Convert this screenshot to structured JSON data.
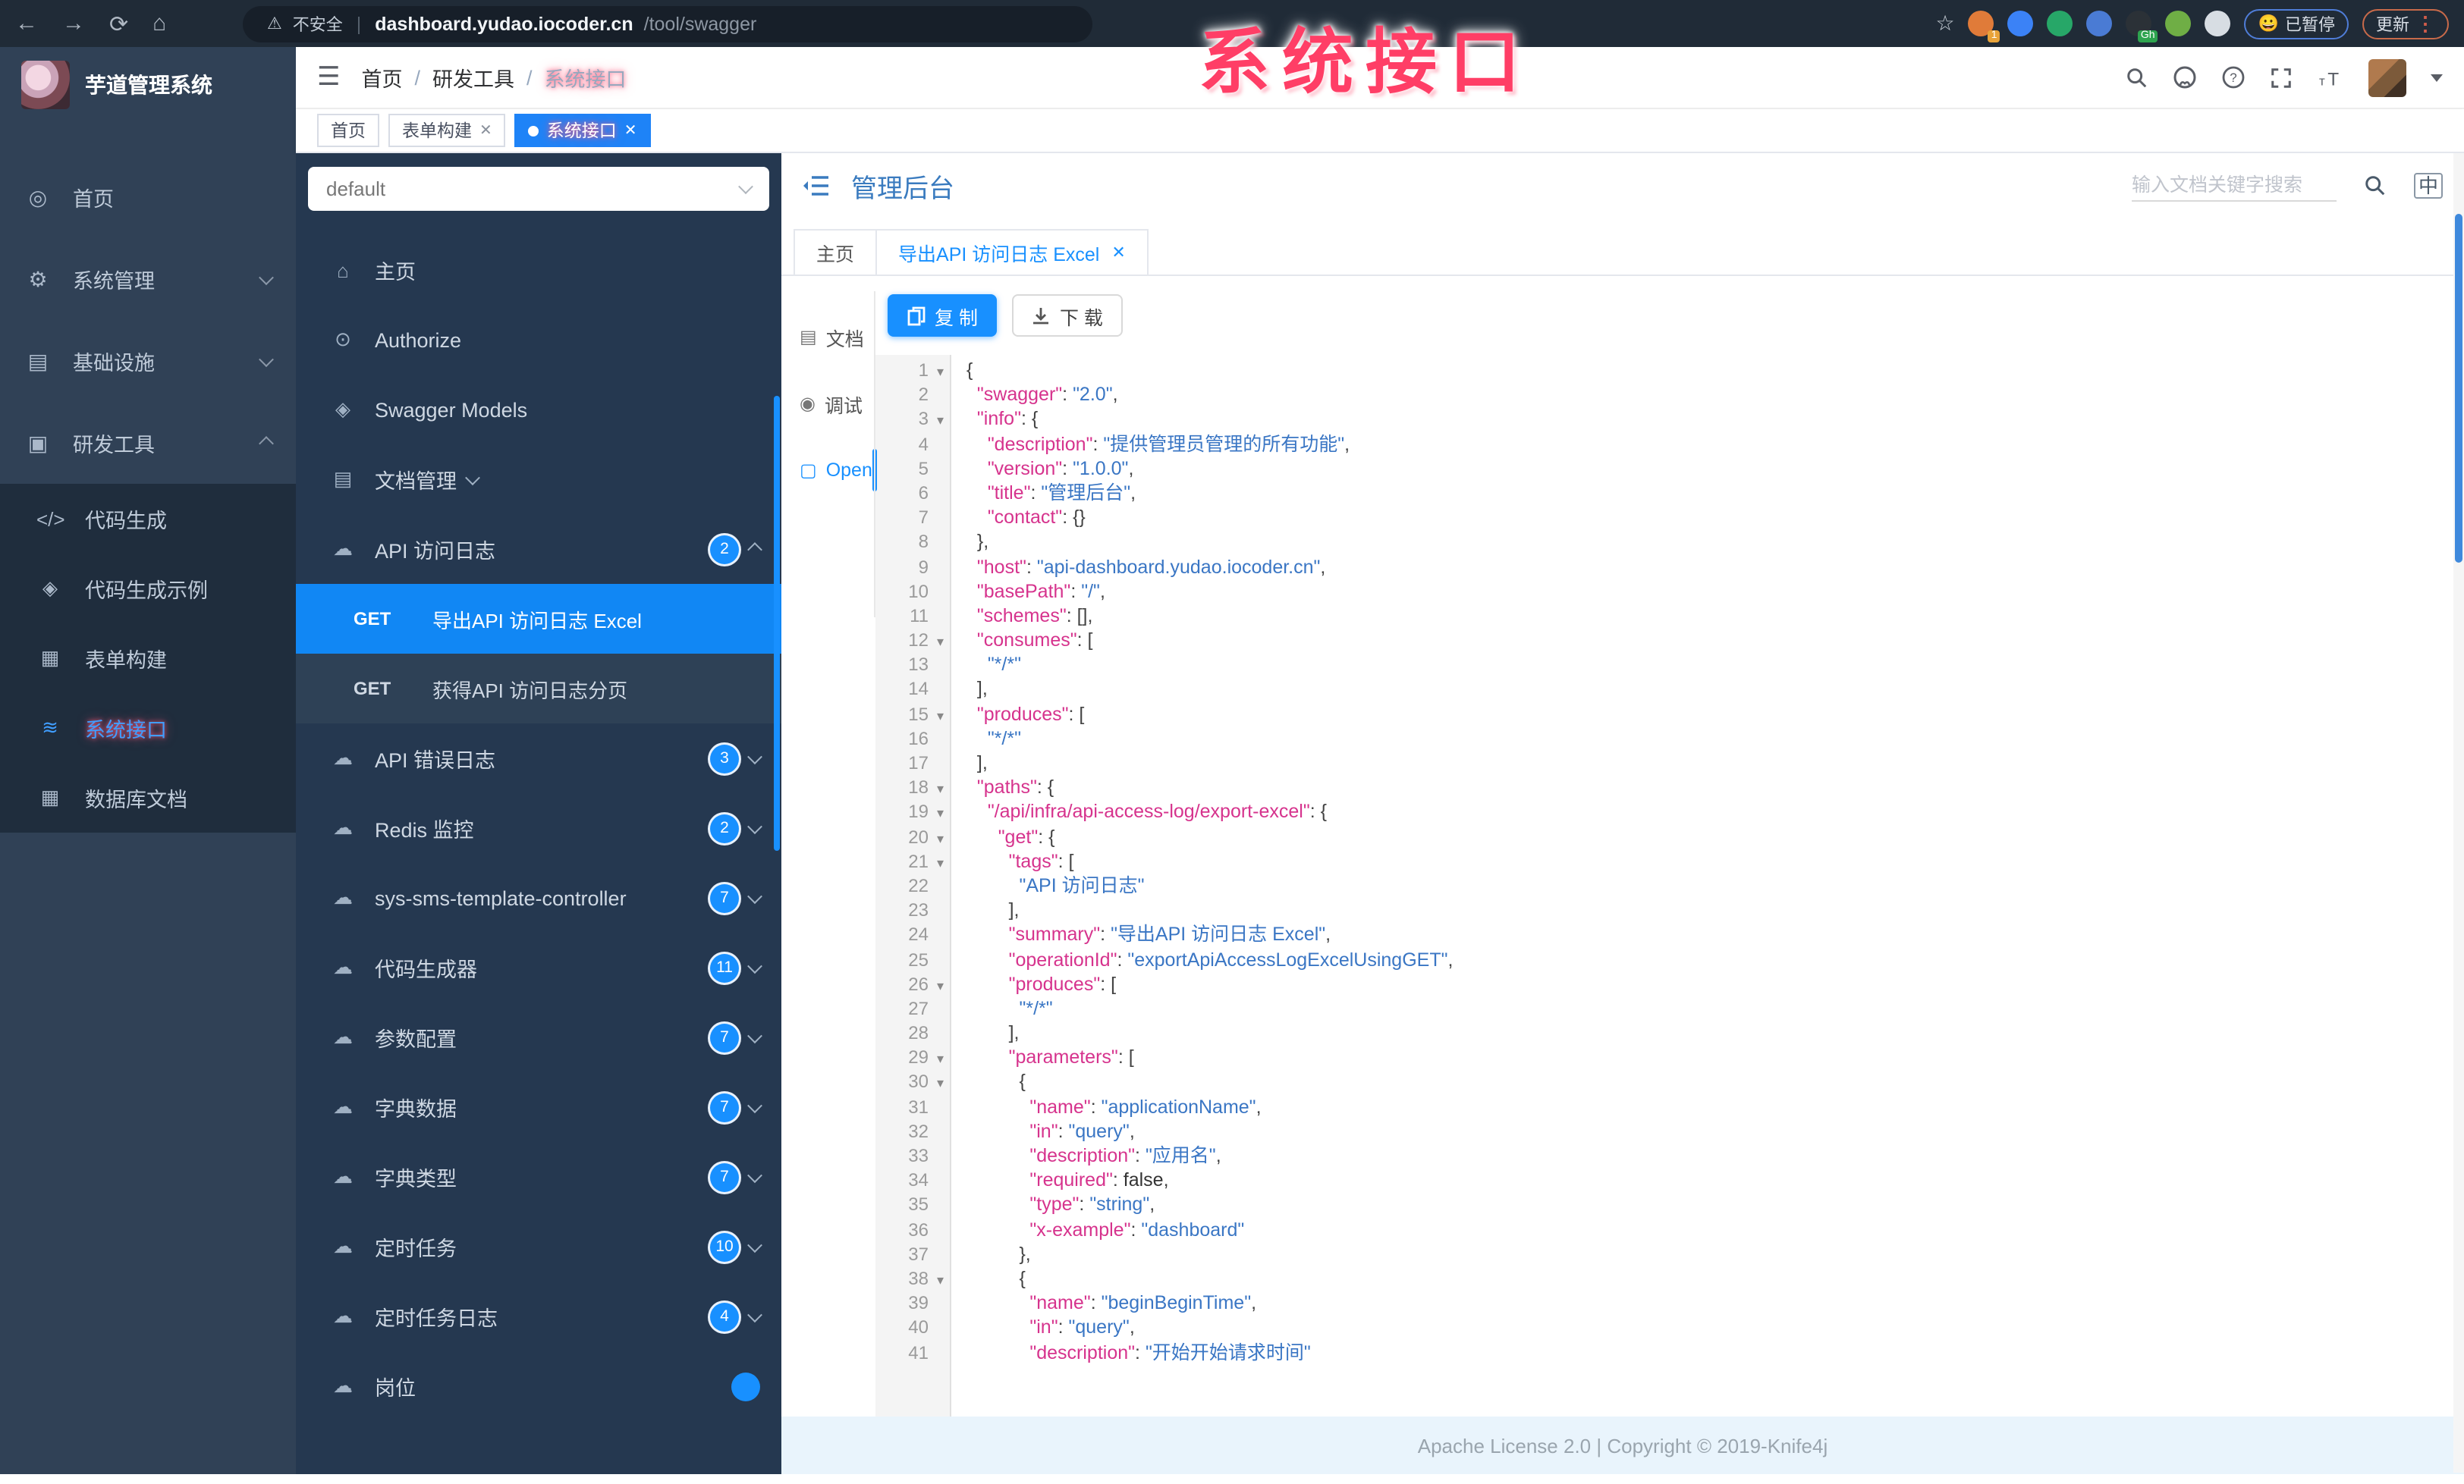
{
  "browser": {
    "back_icon": "←",
    "forward_icon": "→",
    "reload_icon": "⟳",
    "home_icon": "⌂",
    "warning_icon": "⚠",
    "security_label": "不安全",
    "url_host": "dashboard.yudao.iocoder.cn",
    "url_path": "/tool/swagger",
    "bookmark_icon": "☆",
    "extensions": [
      {
        "name": "ext-orange-icon",
        "color": "#e07b39",
        "badge": "1"
      },
      {
        "name": "ext-blue-drop-icon",
        "color": "#3b82f6",
        "badge": ""
      },
      {
        "name": "ext-green-check-icon",
        "color": "#27a768",
        "badge": ""
      },
      {
        "name": "ext-blue-puzzle-icon",
        "color": "#4a7bd4",
        "badge": ""
      },
      {
        "name": "ext-github-icon",
        "color": "#2b3137",
        "badge": "Gh"
      },
      {
        "name": "ext-green-alien-icon",
        "color": "#6fae45",
        "badge": ""
      },
      {
        "name": "ext-white-paw-icon",
        "color": "#d7dde3",
        "badge": ""
      }
    ],
    "paused_pill": "已暂停",
    "paused_emoji": "😀",
    "update_pill": "更新",
    "menu_dots": "⋮"
  },
  "annotation": {
    "text": "系统接口"
  },
  "app_sidebar": {
    "title": "芋道管理系统",
    "items": [
      {
        "label": "首页",
        "icon": "dashboard-icon",
        "glyph": "◎",
        "type": "top"
      },
      {
        "label": "系统管理",
        "icon": "gear-icon",
        "glyph": "⚙",
        "type": "top",
        "chev": "down"
      },
      {
        "label": "基础设施",
        "icon": "infrastructure-icon",
        "glyph": "▤",
        "type": "top",
        "chev": "down"
      },
      {
        "label": "研发工具",
        "icon": "dev-tools-icon",
        "glyph": "▣",
        "type": "top",
        "chev": "up"
      },
      {
        "label": "代码生成",
        "icon": "code-icon",
        "glyph": "</>",
        "type": "sub"
      },
      {
        "label": "代码生成示例",
        "icon": "shield-check-icon",
        "glyph": "◈",
        "type": "sub"
      },
      {
        "label": "表单构建",
        "icon": "form-icon",
        "glyph": "▦",
        "type": "sub"
      },
      {
        "label": "系统接口",
        "icon": "api-icon",
        "glyph": "≋",
        "type": "sub",
        "active": true
      },
      {
        "label": "数据库文档",
        "icon": "database-icon",
        "glyph": "▦",
        "type": "sub"
      }
    ]
  },
  "header": {
    "breadcrumb": [
      "首页",
      "研发工具",
      "系统接口"
    ],
    "separator": "/"
  },
  "tags": [
    {
      "label": "首页",
      "closable": false,
      "active": false
    },
    {
      "label": "表单构建",
      "closable": true,
      "active": false
    },
    {
      "label": "系统接口",
      "closable": true,
      "active": true
    }
  ],
  "swagger_sidebar": {
    "group_selected": "default",
    "items": [
      {
        "label": "主页",
        "icon": "home-icon",
        "glyph": "⌂"
      },
      {
        "label": "Authorize",
        "icon": "authorize-icon",
        "glyph": "⊙"
      },
      {
        "label": "Swagger Models",
        "icon": "models-icon",
        "glyph": "◈"
      },
      {
        "label": "文档管理",
        "icon": "doc-manage-icon",
        "glyph": "▤",
        "chev": "down"
      },
      {
        "label": "API 访问日志",
        "icon": "api-group-icon",
        "glyph": "☁",
        "badge": "2",
        "chev": "up"
      },
      {
        "type": "op",
        "method": "GET",
        "label": "导出API 访问日志 Excel",
        "active": true
      },
      {
        "type": "op",
        "method": "GET",
        "label": "获得API 访问日志分页"
      },
      {
        "label": "API 错误日志",
        "icon": "api-group-icon",
        "glyph": "☁",
        "badge": "3",
        "chev": "down"
      },
      {
        "label": "Redis 监控",
        "icon": "api-group-icon",
        "glyph": "☁",
        "badge": "2",
        "chev": "down"
      },
      {
        "label": "sys-sms-template-controller",
        "icon": "api-group-icon",
        "glyph": "☁",
        "badge": "7",
        "chev": "down"
      },
      {
        "label": "代码生成器",
        "icon": "api-group-icon",
        "glyph": "☁",
        "badge": "11",
        "chev": "down"
      },
      {
        "label": "参数配置",
        "icon": "api-group-icon",
        "glyph": "☁",
        "badge": "7",
        "chev": "down"
      },
      {
        "label": "字典数据",
        "icon": "api-group-icon",
        "glyph": "☁",
        "badge": "7",
        "chev": "down"
      },
      {
        "label": "字典类型",
        "icon": "api-group-icon",
        "glyph": "☁",
        "badge": "7",
        "chev": "down"
      },
      {
        "label": "定时任务",
        "icon": "api-group-icon",
        "glyph": "☁",
        "badge": "10",
        "chev": "down"
      },
      {
        "label": "定时任务日志",
        "icon": "api-group-icon",
        "glyph": "☁",
        "badge": "4",
        "chev": "down"
      },
      {
        "label": "岗位",
        "icon": "api-group-icon",
        "glyph": "☁",
        "partial": true
      }
    ]
  },
  "doc_panel": {
    "title": "管理后台",
    "search_placeholder": "输入文档关键字搜索",
    "lang_toggle": "中",
    "tabs": [
      {
        "label": "主页",
        "closable": false,
        "active": false
      },
      {
        "label": "导出API 访问日志 Excel",
        "closable": true,
        "active": true
      }
    ],
    "mini_nav": [
      {
        "label": "文档",
        "icon": "doc-icon",
        "glyph": "▤"
      },
      {
        "label": "调试",
        "icon": "debug-icon",
        "glyph": "◉"
      },
      {
        "label": "Open",
        "icon": "open-file-icon",
        "glyph": "▢",
        "active": true
      }
    ],
    "copy_label": "复 制",
    "download_label": "下 载",
    "footer": "Apache License 2.0 | Copyright © 2019-Knife4j"
  },
  "code": {
    "lines": [
      {
        "n": 1,
        "fold": true,
        "seg": [
          [
            "p",
            "{"
          ]
        ]
      },
      {
        "n": 2,
        "fold": false,
        "seg": [
          [
            "p",
            "  "
          ],
          [
            "k",
            "\"swagger\""
          ],
          [
            "p",
            ": "
          ],
          [
            "s",
            "\"2.0\""
          ],
          [
            "p",
            ","
          ]
        ]
      },
      {
        "n": 3,
        "fold": true,
        "seg": [
          [
            "p",
            "  "
          ],
          [
            "k",
            "\"info\""
          ],
          [
            "p",
            ": {"
          ]
        ]
      },
      {
        "n": 4,
        "fold": false,
        "seg": [
          [
            "p",
            "    "
          ],
          [
            "k",
            "\"description\""
          ],
          [
            "p",
            ": "
          ],
          [
            "s",
            "\"提供管理员管理的所有功能\""
          ],
          [
            "p",
            ","
          ]
        ]
      },
      {
        "n": 5,
        "fold": false,
        "seg": [
          [
            "p",
            "    "
          ],
          [
            "k",
            "\"version\""
          ],
          [
            "p",
            ": "
          ],
          [
            "s",
            "\"1.0.0\""
          ],
          [
            "p",
            ","
          ]
        ]
      },
      {
        "n": 6,
        "fold": false,
        "seg": [
          [
            "p",
            "    "
          ],
          [
            "k",
            "\"title\""
          ],
          [
            "p",
            ": "
          ],
          [
            "s",
            "\"管理后台\""
          ],
          [
            "p",
            ","
          ]
        ]
      },
      {
        "n": 7,
        "fold": false,
        "seg": [
          [
            "p",
            "    "
          ],
          [
            "k",
            "\"contact\""
          ],
          [
            "p",
            ": {}"
          ]
        ]
      },
      {
        "n": 8,
        "fold": false,
        "seg": [
          [
            "p",
            "  },"
          ]
        ]
      },
      {
        "n": 9,
        "fold": false,
        "seg": [
          [
            "p",
            "  "
          ],
          [
            "k",
            "\"host\""
          ],
          [
            "p",
            ": "
          ],
          [
            "s",
            "\"api-dashboard.yudao.iocoder.cn\""
          ],
          [
            "p",
            ","
          ]
        ]
      },
      {
        "n": 10,
        "fold": false,
        "seg": [
          [
            "p",
            "  "
          ],
          [
            "k",
            "\"basePath\""
          ],
          [
            "p",
            ": "
          ],
          [
            "s",
            "\"/\""
          ],
          [
            "p",
            ","
          ]
        ]
      },
      {
        "n": 11,
        "fold": false,
        "seg": [
          [
            "p",
            "  "
          ],
          [
            "k",
            "\"schemes\""
          ],
          [
            "p",
            ": [],"
          ]
        ]
      },
      {
        "n": 12,
        "fold": true,
        "seg": [
          [
            "p",
            "  "
          ],
          [
            "k",
            "\"consumes\""
          ],
          [
            "p",
            ": ["
          ]
        ]
      },
      {
        "n": 13,
        "fold": false,
        "seg": [
          [
            "p",
            "    "
          ],
          [
            "s",
            "\"*/*\""
          ]
        ]
      },
      {
        "n": 14,
        "fold": false,
        "seg": [
          [
            "p",
            "  ],"
          ]
        ]
      },
      {
        "n": 15,
        "fold": true,
        "seg": [
          [
            "p",
            "  "
          ],
          [
            "k",
            "\"produces\""
          ],
          [
            "p",
            ": ["
          ]
        ]
      },
      {
        "n": 16,
        "fold": false,
        "seg": [
          [
            "p",
            "    "
          ],
          [
            "s",
            "\"*/*\""
          ]
        ]
      },
      {
        "n": 17,
        "fold": false,
        "seg": [
          [
            "p",
            "  ],"
          ]
        ]
      },
      {
        "n": 18,
        "fold": true,
        "seg": [
          [
            "p",
            "  "
          ],
          [
            "k",
            "\"paths\""
          ],
          [
            "p",
            ": {"
          ]
        ]
      },
      {
        "n": 19,
        "fold": true,
        "seg": [
          [
            "p",
            "    "
          ],
          [
            "k",
            "\"/api/infra/api-access-log/export-excel\""
          ],
          [
            "p",
            ": {"
          ]
        ]
      },
      {
        "n": 20,
        "fold": true,
        "seg": [
          [
            "p",
            "      "
          ],
          [
            "k",
            "\"get\""
          ],
          [
            "p",
            ": {"
          ]
        ]
      },
      {
        "n": 21,
        "fold": true,
        "seg": [
          [
            "p",
            "        "
          ],
          [
            "k",
            "\"tags\""
          ],
          [
            "p",
            ": ["
          ]
        ]
      },
      {
        "n": 22,
        "fold": false,
        "seg": [
          [
            "p",
            "          "
          ],
          [
            "s",
            "\"API 访问日志\""
          ]
        ]
      },
      {
        "n": 23,
        "fold": false,
        "seg": [
          [
            "p",
            "        ],"
          ]
        ]
      },
      {
        "n": 24,
        "fold": false,
        "seg": [
          [
            "p",
            "        "
          ],
          [
            "k",
            "\"summary\""
          ],
          [
            "p",
            ": "
          ],
          [
            "s",
            "\"导出API 访问日志 Excel\""
          ],
          [
            "p",
            ","
          ]
        ]
      },
      {
        "n": 25,
        "fold": false,
        "seg": [
          [
            "p",
            "        "
          ],
          [
            "k",
            "\"operationId\""
          ],
          [
            "p",
            ": "
          ],
          [
            "s",
            "\"exportApiAccessLogExcelUsingGET\""
          ],
          [
            "p",
            ","
          ]
        ]
      },
      {
        "n": 26,
        "fold": true,
        "seg": [
          [
            "p",
            "        "
          ],
          [
            "k",
            "\"produces\""
          ],
          [
            "p",
            ": ["
          ]
        ]
      },
      {
        "n": 27,
        "fold": false,
        "seg": [
          [
            "p",
            "          "
          ],
          [
            "s",
            "\"*/*\""
          ]
        ]
      },
      {
        "n": 28,
        "fold": false,
        "seg": [
          [
            "p",
            "        ],"
          ]
        ]
      },
      {
        "n": 29,
        "fold": true,
        "seg": [
          [
            "p",
            "        "
          ],
          [
            "k",
            "\"parameters\""
          ],
          [
            "p",
            ": ["
          ]
        ]
      },
      {
        "n": 30,
        "fold": true,
        "seg": [
          [
            "p",
            "          {"
          ]
        ]
      },
      {
        "n": 31,
        "fold": false,
        "seg": [
          [
            "p",
            "            "
          ],
          [
            "k",
            "\"name\""
          ],
          [
            "p",
            ": "
          ],
          [
            "s",
            "\"applicationName\""
          ],
          [
            "p",
            ","
          ]
        ]
      },
      {
        "n": 32,
        "fold": false,
        "seg": [
          [
            "p",
            "            "
          ],
          [
            "k",
            "\"in\""
          ],
          [
            "p",
            ": "
          ],
          [
            "s",
            "\"query\""
          ],
          [
            "p",
            ","
          ]
        ]
      },
      {
        "n": 33,
        "fold": false,
        "seg": [
          [
            "p",
            "            "
          ],
          [
            "k",
            "\"description\""
          ],
          [
            "p",
            ": "
          ],
          [
            "s",
            "\"应用名\""
          ],
          [
            "p",
            ","
          ]
        ]
      },
      {
        "n": 34,
        "fold": false,
        "seg": [
          [
            "p",
            "            "
          ],
          [
            "k",
            "\"required\""
          ],
          [
            "p",
            ": "
          ],
          [
            "b",
            "false"
          ],
          [
            "p",
            ","
          ]
        ]
      },
      {
        "n": 35,
        "fold": false,
        "seg": [
          [
            "p",
            "            "
          ],
          [
            "k",
            "\"type\""
          ],
          [
            "p",
            ": "
          ],
          [
            "s",
            "\"string\""
          ],
          [
            "p",
            ","
          ]
        ]
      },
      {
        "n": 36,
        "fold": false,
        "seg": [
          [
            "p",
            "            "
          ],
          [
            "k",
            "\"x-example\""
          ],
          [
            "p",
            ": "
          ],
          [
            "s",
            "\"dashboard\""
          ]
        ]
      },
      {
        "n": 37,
        "fold": false,
        "seg": [
          [
            "p",
            "          },"
          ]
        ]
      },
      {
        "n": 38,
        "fold": true,
        "seg": [
          [
            "p",
            "          {"
          ]
        ]
      },
      {
        "n": 39,
        "fold": false,
        "seg": [
          [
            "p",
            "            "
          ],
          [
            "k",
            "\"name\""
          ],
          [
            "p",
            ": "
          ],
          [
            "s",
            "\"beginBeginTime\""
          ],
          [
            "p",
            ","
          ]
        ]
      },
      {
        "n": 40,
        "fold": false,
        "seg": [
          [
            "p",
            "            "
          ],
          [
            "k",
            "\"in\""
          ],
          [
            "p",
            ": "
          ],
          [
            "s",
            "\"query\""
          ],
          [
            "p",
            ","
          ]
        ]
      },
      {
        "n": 41,
        "fold": false,
        "seg": [
          [
            "p",
            "            "
          ],
          [
            "k",
            "\"description\""
          ],
          [
            "p",
            ": "
          ],
          [
            "s",
            "\"开始开始请求时间\""
          ]
        ]
      }
    ]
  }
}
